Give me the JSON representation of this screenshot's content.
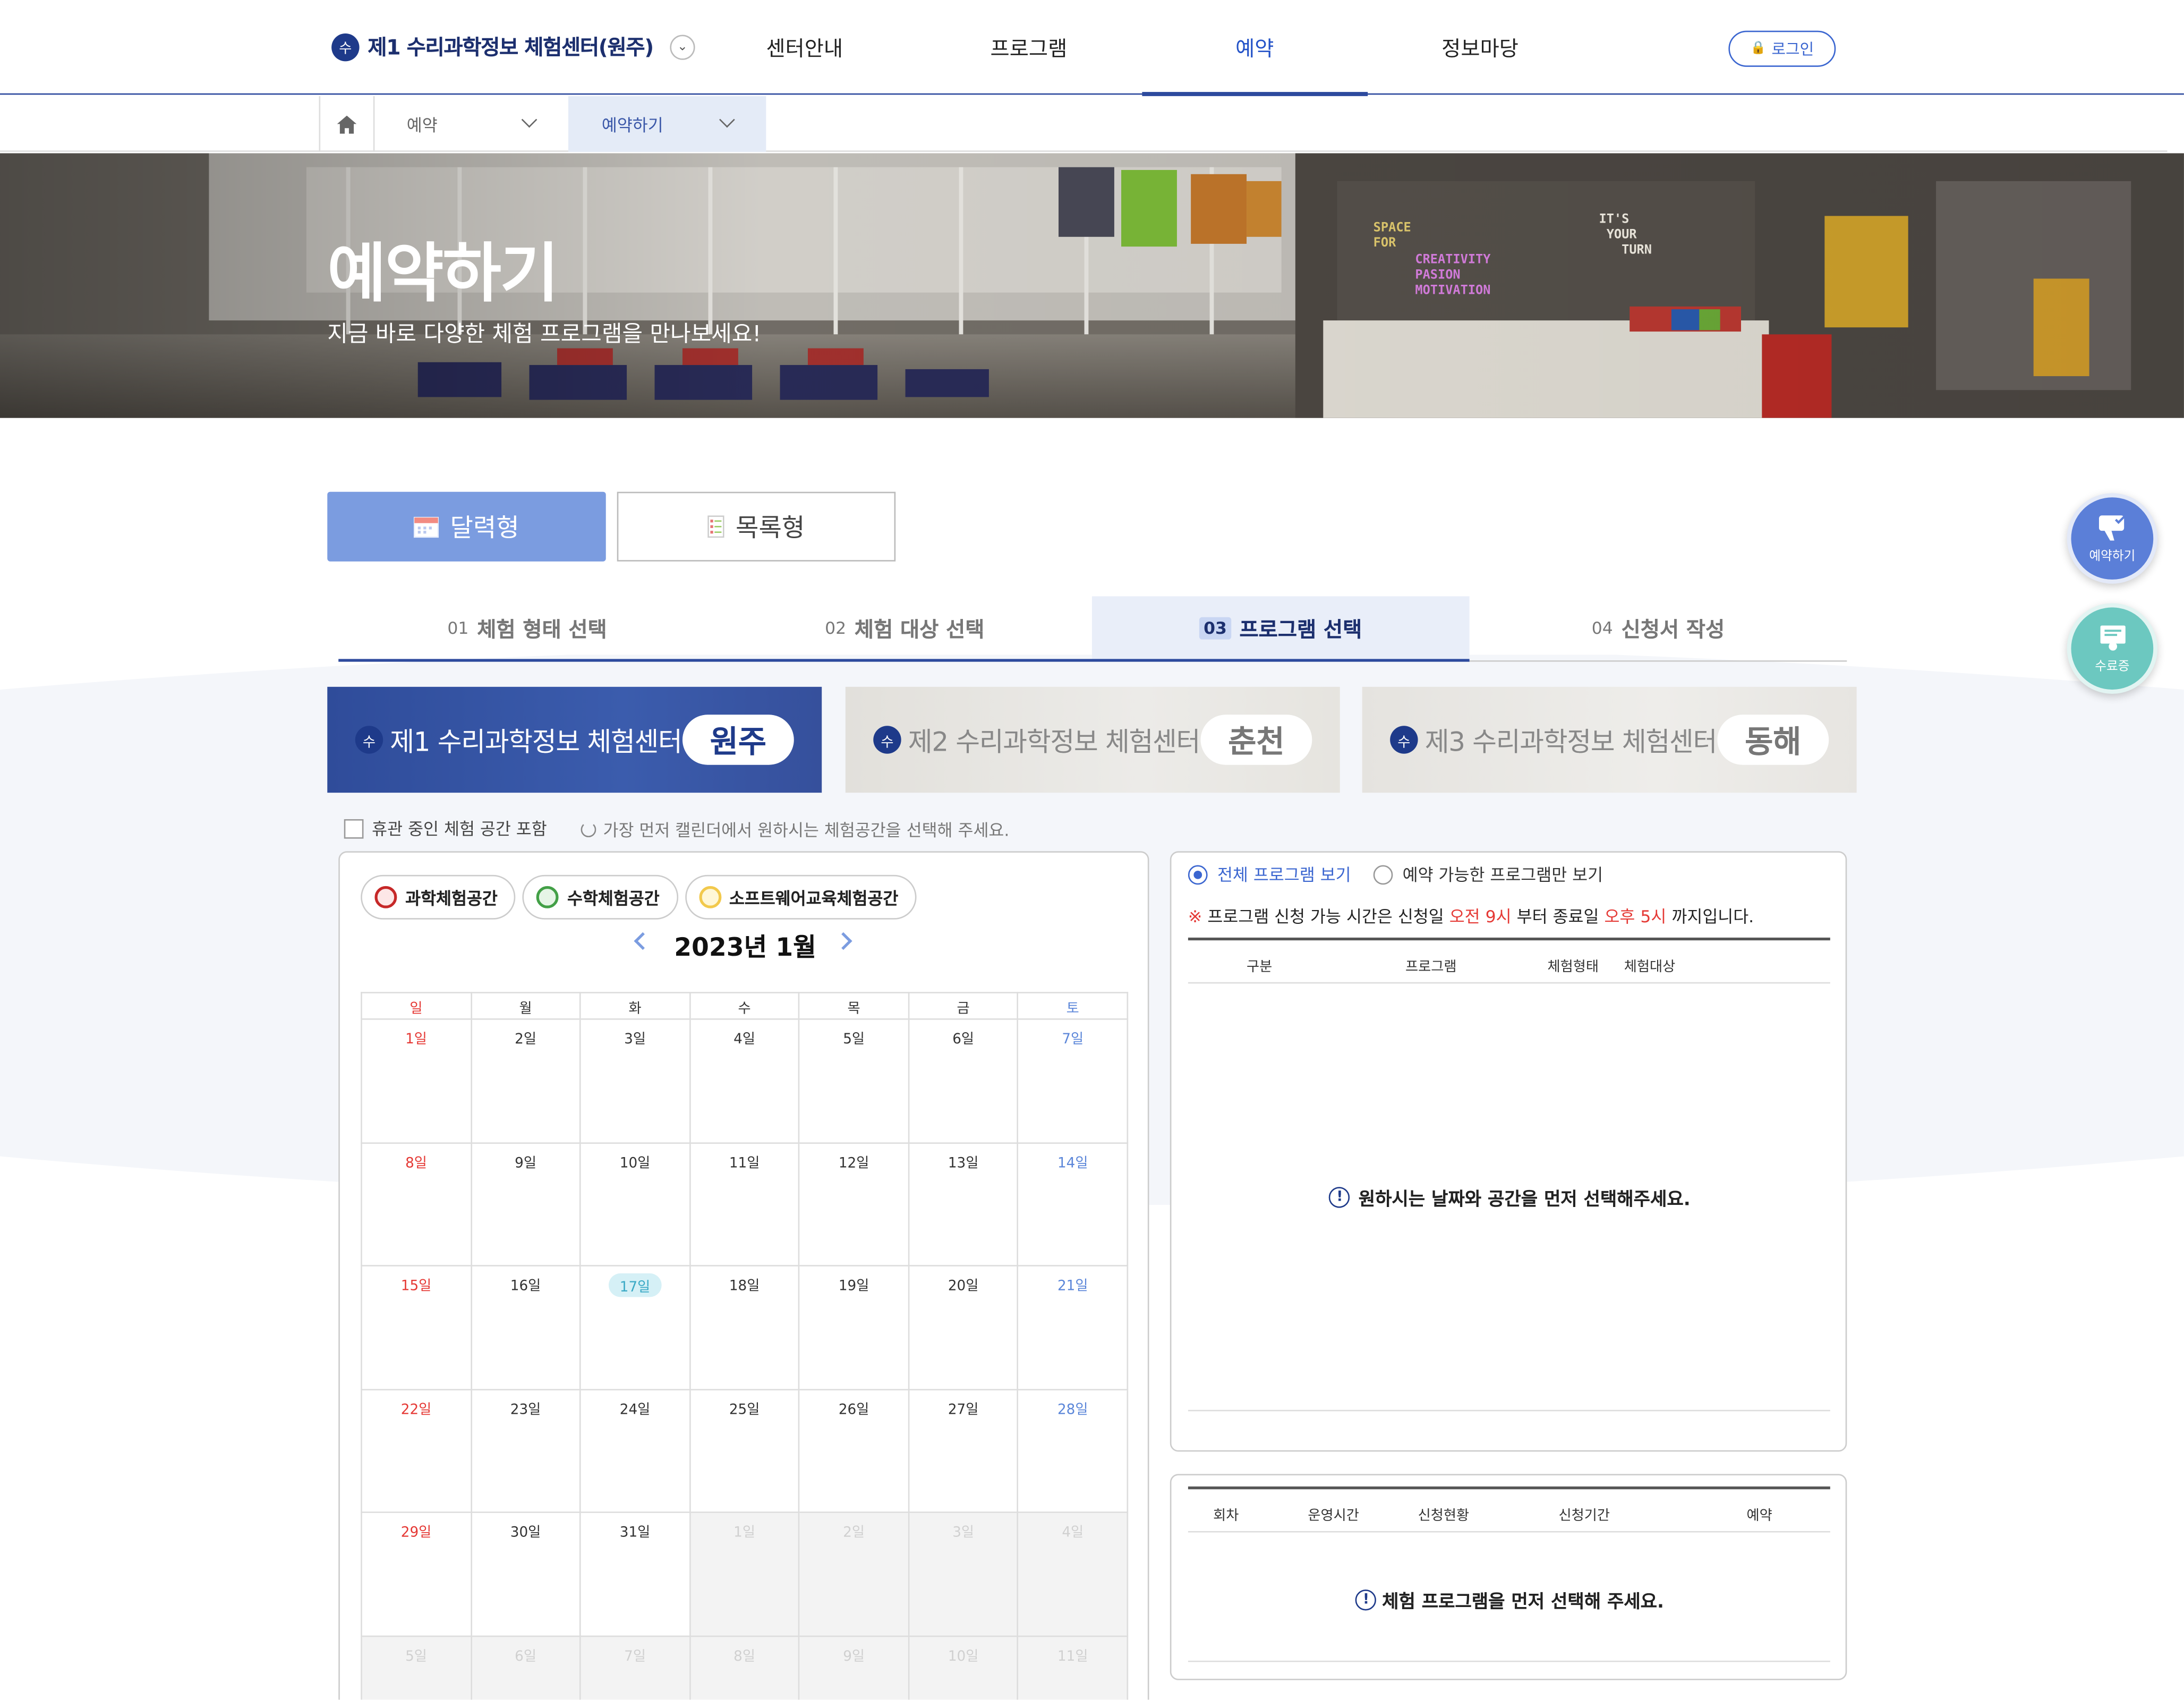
{
  "header": {
    "logo_mark": "수",
    "logo_text": "제1 수리과학정보 체험센터(원주)",
    "logo_toggle": "⌄",
    "nav": [
      "센터안내",
      "프로그램",
      "예약",
      "정보마당"
    ],
    "active_nav": "예약",
    "login_label": "로그인",
    "lock_icon": "🔒"
  },
  "breadcrumb": {
    "home_icon": "⌂",
    "level1": "예약",
    "level2": "예약하기"
  },
  "hero": {
    "title": "예약하기",
    "subtitle": "지금 바로 다양한 체험 프로그램을 만나보세요!",
    "sign_left": "SPACE\nFOR",
    "sign_words": "CREATIVITY\nPASION\nMOTIVATION",
    "sign_right": "IT'S\n YOUR\n   TURN"
  },
  "view_toggle": {
    "calendar_label": "달력형",
    "list_label": "목록형",
    "selected": "달력형"
  },
  "steps": [
    {
      "num": "01",
      "label": "체험 형태 선택"
    },
    {
      "num": "02",
      "label": "체험 대상 선택"
    },
    {
      "num": "03",
      "label": "프로그램 선택"
    },
    {
      "num": "04",
      "label": "신청서 작성"
    }
  ],
  "active_step": "03",
  "centers": [
    {
      "name": "제1 수리과학정보 체험센터",
      "city": "원주"
    },
    {
      "name": "제2 수리과학정보 체험센터",
      "city": "춘천"
    },
    {
      "name": "제3 수리과학정보 체험센터",
      "city": "동해"
    }
  ],
  "selected_center": "원주",
  "options": {
    "include_closed_label": "휴관 중인 체험 공간 포함",
    "hint": "가장 먼저 캘린더에서 원하시는 체험공간을 선택해 주세요."
  },
  "space_tags": [
    {
      "label": "과학체험공간",
      "color": "#c62828"
    },
    {
      "label": "수학체험공간",
      "color": "#43a047"
    },
    {
      "label": "소프트웨어교육체험공간",
      "color": "#f2c94c"
    }
  ],
  "calendar": {
    "title": "2023년 1월",
    "weekdays": [
      "일",
      "월",
      "화",
      "수",
      "목",
      "금",
      "토"
    ],
    "weeks": [
      [
        "1일",
        "2일",
        "3일",
        "4일",
        "5일",
        "6일",
        "7일"
      ],
      [
        "8일",
        "9일",
        "10일",
        "11일",
        "12일",
        "13일",
        "14일"
      ],
      [
        "15일",
        "16일",
        "17일",
        "18일",
        "19일",
        "20일",
        "21일"
      ],
      [
        "22일",
        "23일",
        "24일",
        "25일",
        "26일",
        "27일",
        "28일"
      ],
      [
        "29일",
        "30일",
        "31일",
        "1일",
        "2일",
        "3일",
        "4일"
      ],
      [
        "5일",
        "6일",
        "7일",
        "8일",
        "9일",
        "10일",
        "11일"
      ]
    ],
    "today": "17일"
  },
  "program_panel": {
    "radio_all": "전체 프로그램 보기",
    "radio_available": "예약 가능한 프로그램만 보기",
    "notice_mark": "※",
    "notice_1": "프로그램 신청 가능 시간은 신청일",
    "notice_start": "오전 9시",
    "notice_2": "부터 종료일",
    "notice_end": "오후 5시",
    "notice_3": "까지입니다.",
    "columns": [
      "구분",
      "프로그램",
      "체험형태",
      "체험대상"
    ],
    "empty_message": "원하시는 날짜와 공간을 먼저 선택해주세요."
  },
  "session_panel": {
    "columns": [
      "회차",
      "운영시간",
      "신청현황",
      "신청기간",
      "예약"
    ],
    "empty_message": "체험 프로그램을 먼저 선택해 주세요."
  },
  "floating": {
    "reserve_label": "예약하기",
    "certificate_label": "수료증"
  },
  "colors": {
    "primary": "#1e3a8a",
    "accent": "#3b66d0",
    "calendar_button": "#7b9ce0",
    "sunday": "#e53935",
    "saturday": "#5b86d9",
    "today_highlight": "#d5f0f6"
  }
}
